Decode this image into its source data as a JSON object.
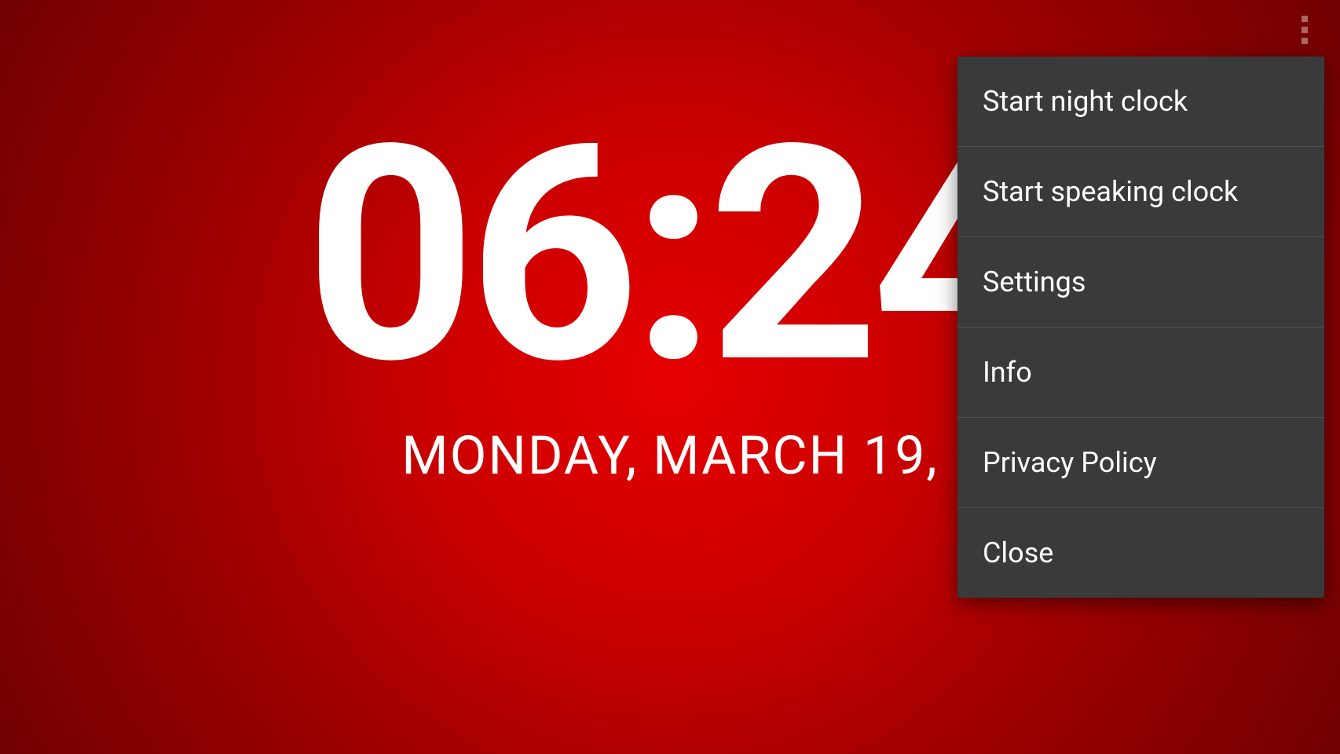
{
  "clock": {
    "time": "06:24",
    "date": "MONDAY, MARCH 19,"
  },
  "menu": {
    "items": [
      {
        "label": "Start night clock"
      },
      {
        "label": "Start speaking clock"
      },
      {
        "label": "Settings"
      },
      {
        "label": "Info"
      },
      {
        "label": "Privacy Policy"
      },
      {
        "label": "Close"
      }
    ]
  }
}
